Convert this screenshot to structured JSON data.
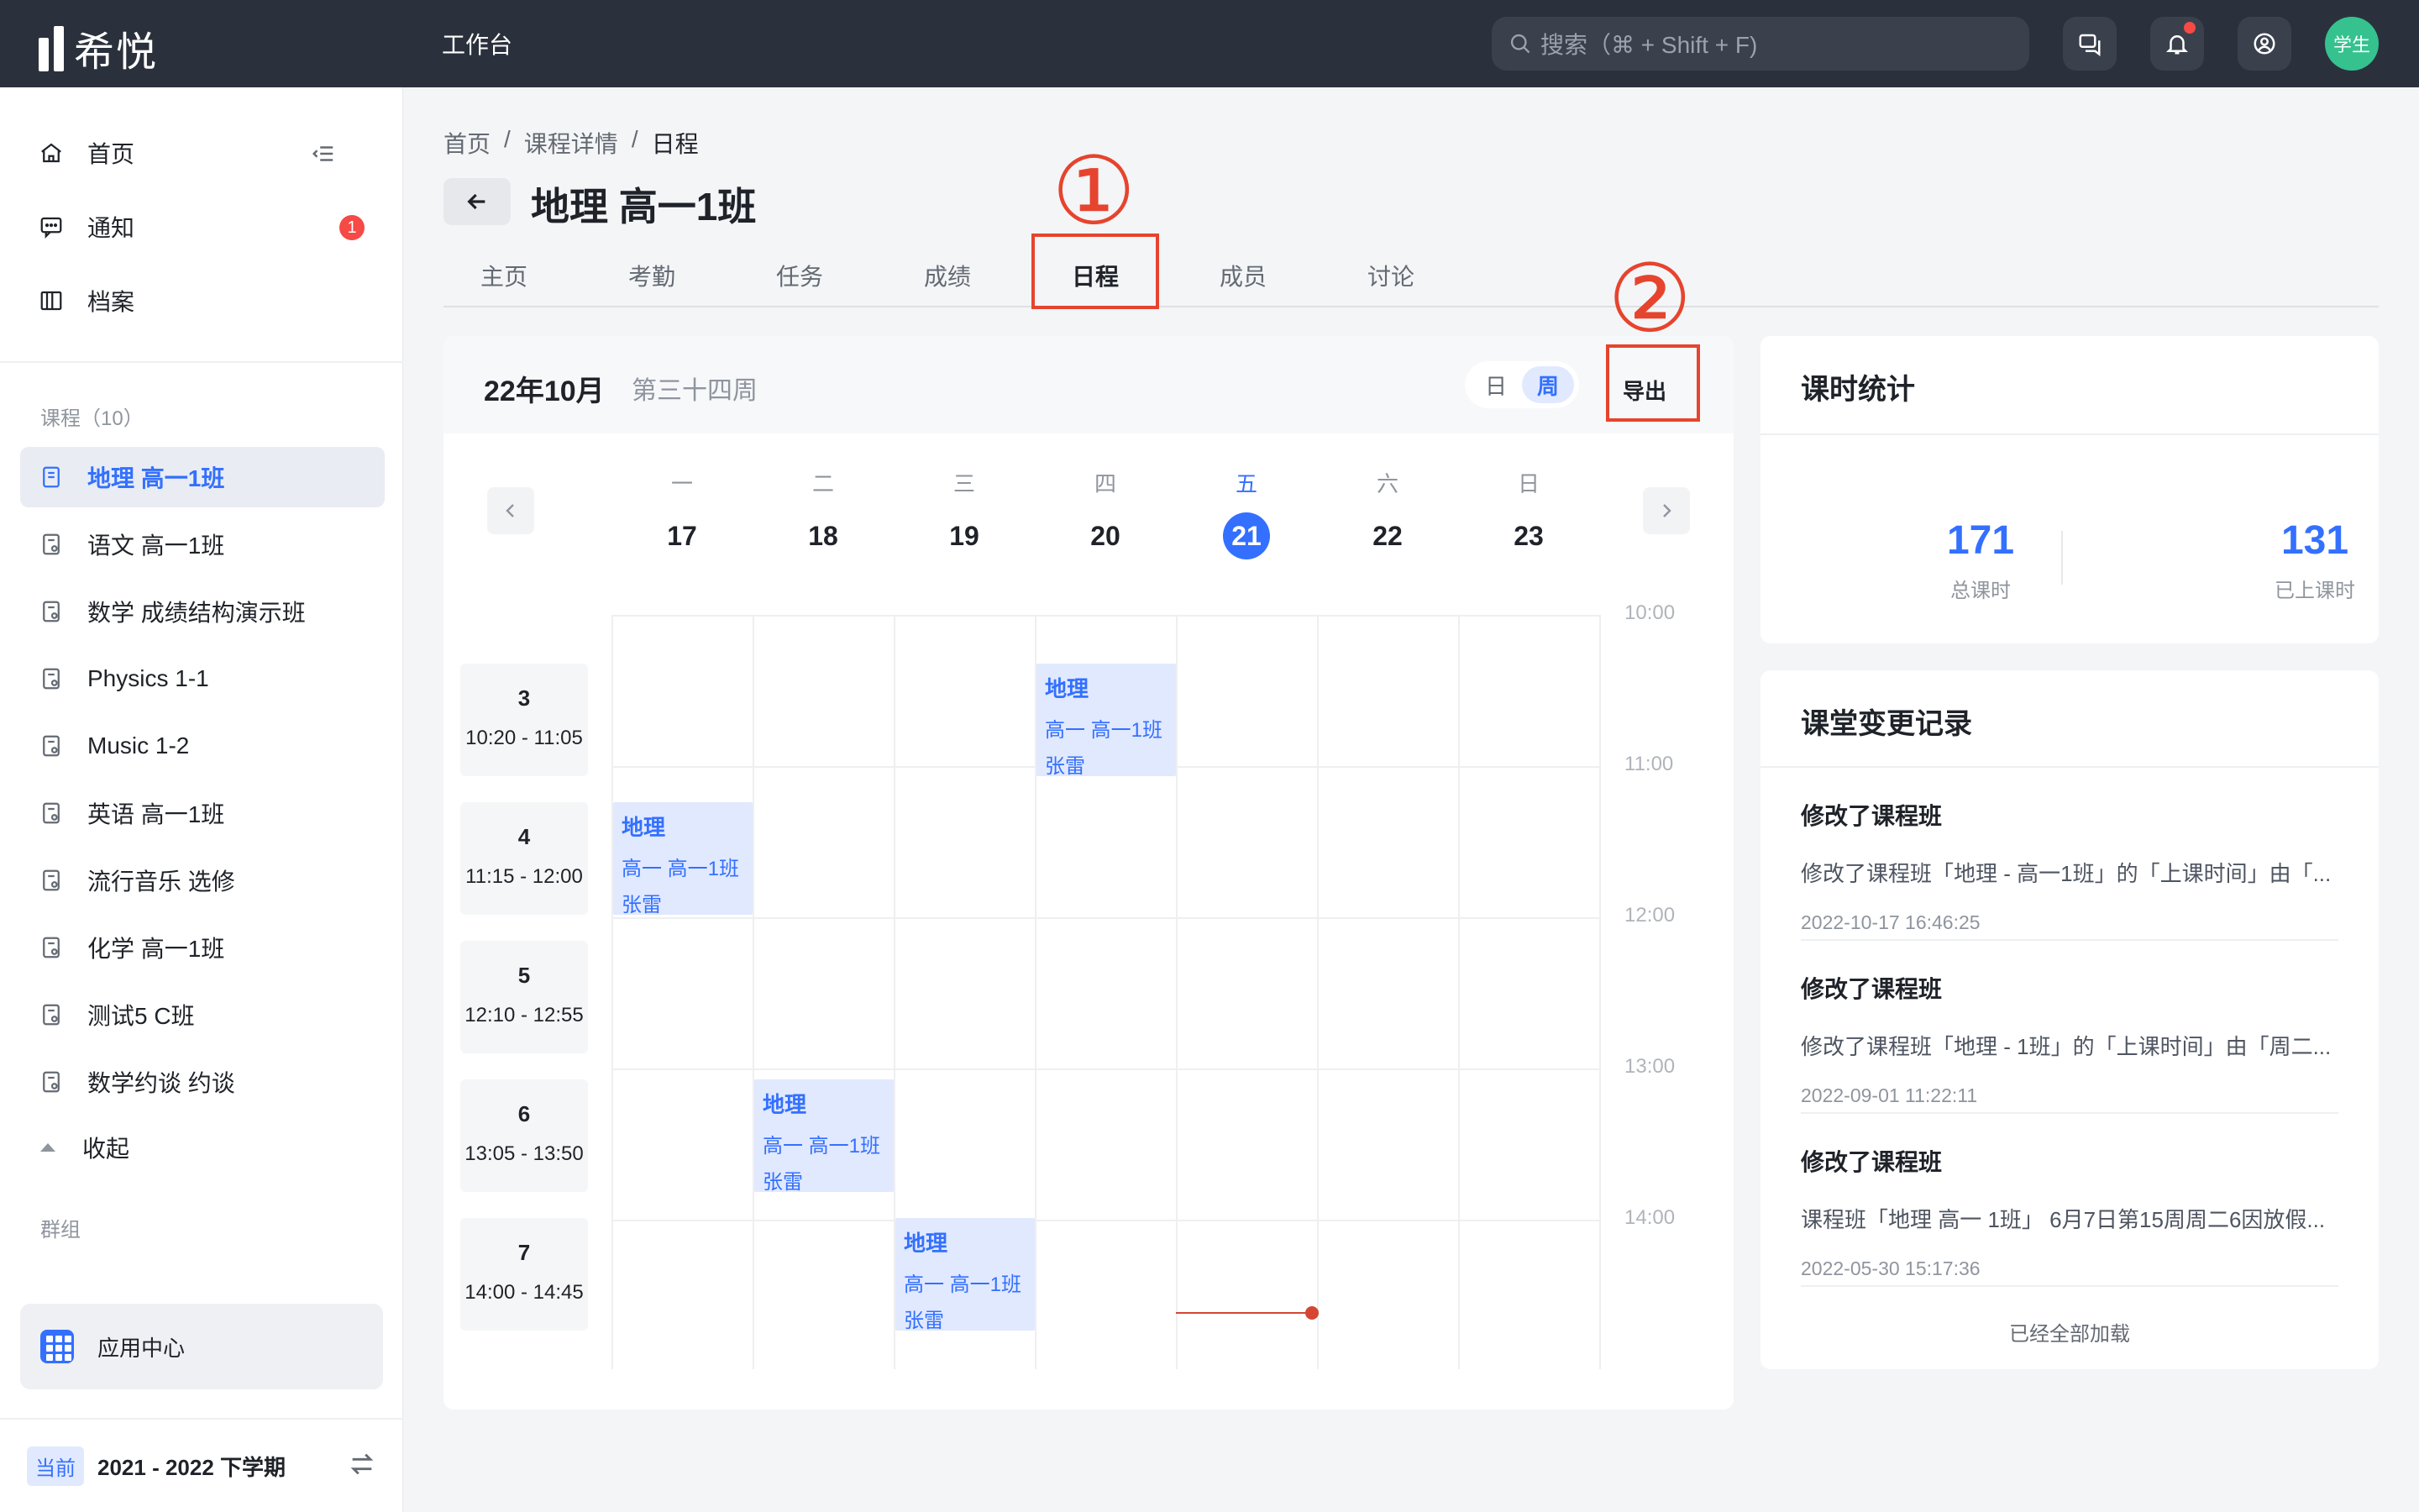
{
  "app": {
    "logo_text": "希悦",
    "workbench": "工作台"
  },
  "search": {
    "placeholder": "搜索（⌘ + Shift + F)"
  },
  "user": {
    "avatar_label": "学生"
  },
  "sidebar": {
    "nav": [
      {
        "label": "首页",
        "icon": "home-icon"
      },
      {
        "label": "通知",
        "icon": "message-icon",
        "badge": "1"
      },
      {
        "label": "档案",
        "icon": "archive-icon"
      }
    ],
    "courses_title": "课程（10）",
    "courses": [
      {
        "label": "地理 高一1班",
        "active": true
      },
      {
        "label": "语文 高一1班"
      },
      {
        "label": "数学 成绩结构演示班"
      },
      {
        "label": "Physics 1-1"
      },
      {
        "label": "Music 1-2"
      },
      {
        "label": "英语 高一1班"
      },
      {
        "label": "流行音乐 选修"
      },
      {
        "label": "化学 高一1班"
      },
      {
        "label": "测试5 C班"
      },
      {
        "label": "数学约谈 约谈"
      }
    ],
    "fold_label": "收起",
    "groups_title": "群组",
    "app_center": "应用中心",
    "term_tag": "当前",
    "term": "2021 - 2022 下学期"
  },
  "breadcrumb": [
    "首页",
    "课程详情",
    "日程"
  ],
  "page_title": "地理 高一1班",
  "tabs": [
    "主页",
    "考勤",
    "任务",
    "成绩",
    "日程",
    "成员",
    "讨论"
  ],
  "active_tab": "日程",
  "annotations": [
    "①",
    "②"
  ],
  "calendar": {
    "month": "22年10月",
    "week": "第三十四周",
    "view_day": "日",
    "view_week": "周",
    "export": "导出",
    "days": [
      {
        "name": "一",
        "num": "17"
      },
      {
        "name": "二",
        "num": "18"
      },
      {
        "name": "三",
        "num": "19"
      },
      {
        "name": "四",
        "num": "20"
      },
      {
        "name": "五",
        "num": "21",
        "today": true
      },
      {
        "name": "六",
        "num": "22"
      },
      {
        "name": "日",
        "num": "23"
      }
    ],
    "hours": [
      "10:00",
      "11:00",
      "12:00",
      "13:00",
      "14:00"
    ],
    "periods": [
      {
        "num": "3",
        "time": "10:20 - 11:05"
      },
      {
        "num": "4",
        "time": "11:15 - 12:00"
      },
      {
        "num": "5",
        "time": "12:10 - 12:55"
      },
      {
        "num": "6",
        "time": "13:05 - 13:50"
      },
      {
        "num": "7",
        "time": "14:00 - 14:45"
      }
    ],
    "events": [
      {
        "day": "四",
        "period": "3",
        "title": "地理",
        "class": "高一  高一1班",
        "teacher": "张雷"
      },
      {
        "day": "一",
        "period": "4",
        "title": "地理",
        "class": "高一  高一1班",
        "teacher": "张雷"
      },
      {
        "day": "二",
        "period": "6",
        "title": "地理",
        "class": "高一  高一1班",
        "teacher": "张雷"
      },
      {
        "day": "三",
        "period": "7",
        "title": "地理",
        "class": "高一  高一1班",
        "teacher": "张雷"
      }
    ]
  },
  "stats": {
    "title": "课时统计",
    "total_value": "171",
    "total_label": "总课时",
    "done_value": "131",
    "done_label": "已上课时"
  },
  "log": {
    "title": "课堂变更记录",
    "entries": [
      {
        "title": "修改了课程班",
        "desc": "修改了课程班「地理 - 高一1班」的「上课时间」由「...",
        "time": "2022-10-17 16:46:25"
      },
      {
        "title": "修改了课程班",
        "desc": "修改了课程班「地理 - 1班」的「上课时间」由「周二...",
        "time": "2022-09-01 11:22:11"
      },
      {
        "title": "修改了课程班",
        "desc": "课程班「地理 高一 1班」 6月7日第15周周二6因放假...",
        "time": "2022-05-30 15:17:36"
      }
    ],
    "footer": "已经全部加载"
  },
  "colors": {
    "accent": "#3370ff",
    "topbar": "#2b313c",
    "annotation_red": "#e6442e",
    "avatar": "#35c28f"
  }
}
